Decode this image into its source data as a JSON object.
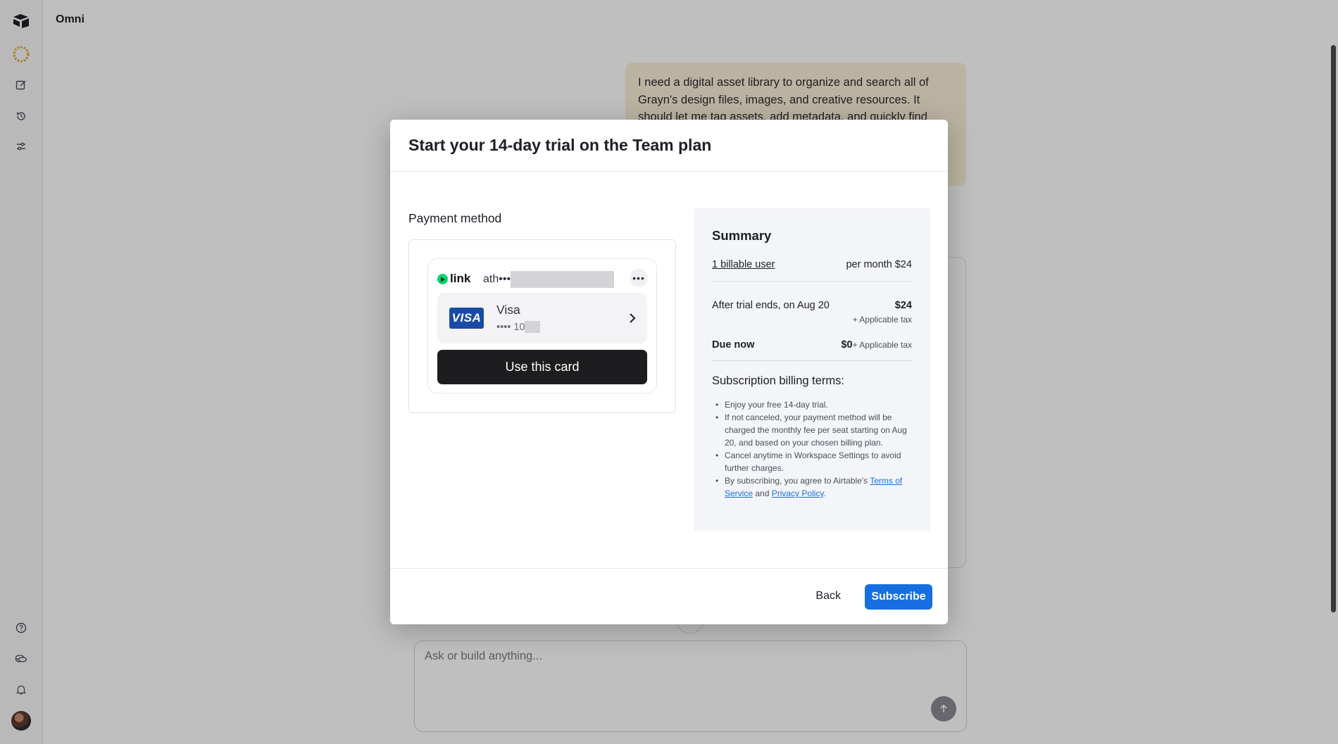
{
  "app": {
    "title": "Omni"
  },
  "sidebar": {
    "top_icons": [
      "airtable-logo-icon",
      "omni-sun-icon",
      "compose-icon",
      "history-icon",
      "sliders-icon"
    ],
    "bottom_icons": [
      "help-icon",
      "coins-icon",
      "bell-icon",
      "avatar"
    ]
  },
  "chat": {
    "message": "I need a digital asset library to organize and search all of Grayn's design files, images, and creative resources. It should let me tag assets, add metadata, and quickly find",
    "input_placeholder": "Ask or build anything..."
  },
  "modal": {
    "title": "Start your 14-day trial on the Team plan",
    "payment_method_label": "Payment method",
    "link": {
      "brand": "link",
      "email_prefix": "ath•••",
      "more_label": "•••"
    },
    "card": {
      "badge": "VISA",
      "name": "Visa",
      "number_prefix": "•••• 10"
    },
    "use_card_label": "Use this card",
    "summary": {
      "title": "Summary",
      "billable_users": "1 billable user",
      "per_month": "per month $24",
      "after_trial_label": "After trial ends, on Aug 20",
      "after_trial_amount": "$24",
      "after_trial_tax": "+ Applicable tax",
      "due_now_label": "Due now",
      "due_now_amount": "$0",
      "due_now_tax": "+ Applicable tax",
      "terms_title": "Subscription billing terms:",
      "terms": [
        "Enjoy your free 14-day trial.",
        "If not canceled, your payment method will be charged the monthly fee per seat starting on Aug 20, and based on your chosen billing plan.",
        "Cancel anytime in Workspace Settings to avoid further charges."
      ],
      "terms_last_prefix": "By subscribing, you agree to Airtable's ",
      "terms_of_service": "Terms of Service",
      "terms_and": " and ",
      "privacy_policy": "Privacy Policy",
      "terms_end": "."
    },
    "back_label": "Back",
    "subscribe_label": "Subscribe"
  },
  "colors": {
    "primary": "#166ee1",
    "link_green": "#00d66f",
    "visa_blue": "#1a4aa8",
    "bubble": "#faefd7"
  }
}
